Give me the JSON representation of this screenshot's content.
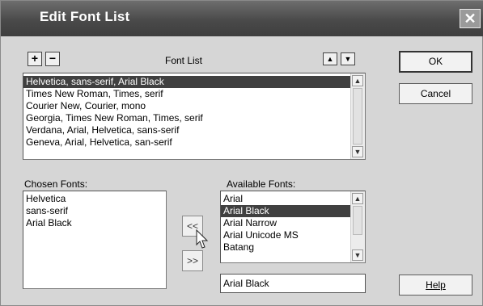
{
  "window": {
    "title": "Edit Font List",
    "close_glyph": "✕"
  },
  "font_list": {
    "add_glyph": "+",
    "remove_glyph": "−",
    "label": "Font List",
    "move_up_glyph": "▲",
    "move_down_glyph": "▼",
    "items": [
      "Helvetica, sans-serif, Arial Black",
      "Times New Roman, Times, serif",
      "Courier New, Courier, mono",
      "Georgia, Times New Roman, Times, serif",
      "Verdana, Arial, Helvetica, sans-serif",
      "Geneva, Arial, Helvetica, san-serif"
    ],
    "selected_index": 0
  },
  "chosen_fonts": {
    "label": "Chosen Fonts:",
    "items": [
      "Helvetica",
      "sans-serif",
      "Arial Black"
    ]
  },
  "transfer": {
    "add_glyph": "<<",
    "remove_glyph": ">>"
  },
  "available_fonts": {
    "label": "Available Fonts:",
    "items": [
      "Arial",
      "Arial Black",
      "Arial Narrow",
      "Arial Unicode MS",
      "Batang"
    ],
    "selected_index": 1,
    "input_value": "Arial Black"
  },
  "buttons": {
    "ok": "OK",
    "cancel": "Cancel",
    "help": "Help"
  },
  "scroll": {
    "up_glyph": "▲",
    "down_glyph": "▼"
  },
  "colors": {
    "titlebar": "#4a4a4a",
    "dialog": "#d6d6d6",
    "selection": "#404040"
  }
}
